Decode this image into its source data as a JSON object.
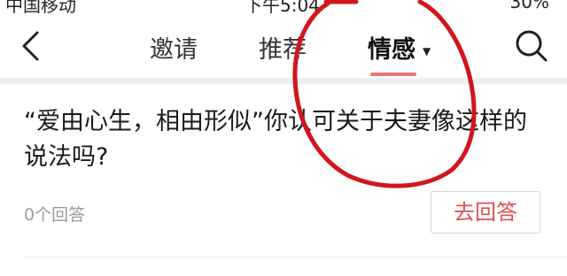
{
  "status_bar": {
    "carrier": "中国移动",
    "time": "下午5:04",
    "battery": "30%"
  },
  "nav": {
    "tabs": [
      {
        "label": "邀请"
      },
      {
        "label": "推荐"
      },
      {
        "label": "情感"
      }
    ],
    "active_tab": "情感",
    "accent_color": "#f0717a"
  },
  "question": {
    "title": "“爱由心生，相由形似”你认可关于夫妻像这样的说法吗?",
    "answer_count": "0个回答",
    "answer_button_label": "去回答"
  },
  "annotation": {
    "color": "#d0161e",
    "shape": "hand-drawn circle around the 情感 tab"
  }
}
